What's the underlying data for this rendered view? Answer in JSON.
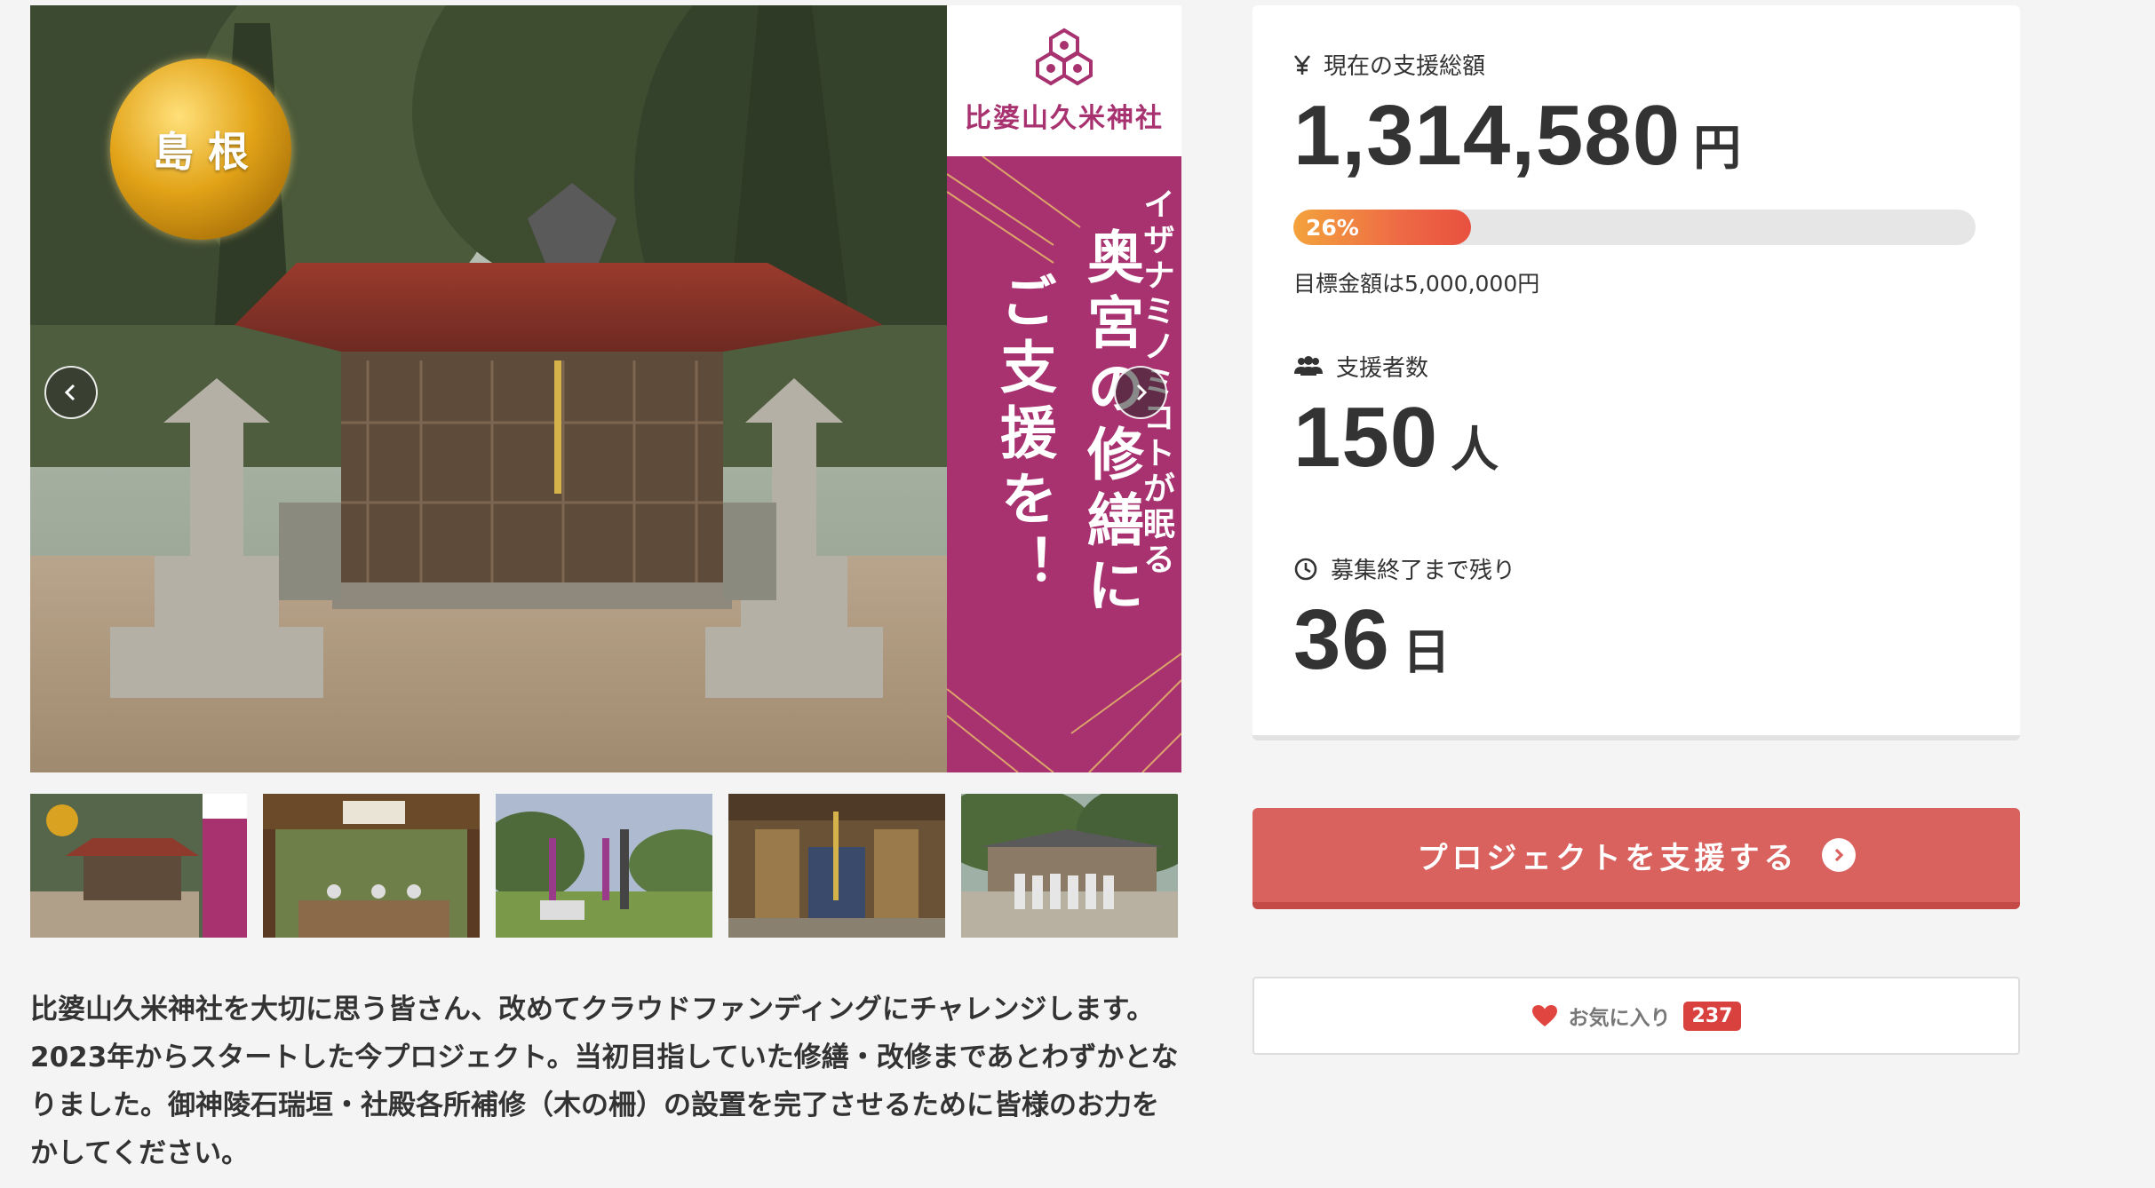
{
  "gallery": {
    "region_badge": "島根",
    "banner": {
      "shrine_name": "比婆山久米神社",
      "subtitle": "イザナミノミコトが眠る",
      "headline_line1": "奥宮の修繕に",
      "headline_line2": "ご支援を！"
    },
    "thumbnail_count": 5
  },
  "description": "比婆山久米神社を大切に思う皆さん、改めてクラウドファンディングにチャレンジします。2023年からスタートした今プロジェクト。当初目指していた修繕・改修まであとわずかとなりました。御神陵石瑞垣・社殿各所補修（木の柵）の設置を完了させるために皆様のお力をかしてください。",
  "stats": {
    "total": {
      "icon": "yen-icon",
      "label": "現在の支援総額",
      "value": "1,314,580",
      "unit": "円"
    },
    "progress": {
      "percent_label": "26%",
      "percent": 26,
      "goal_text": "目標金額は5,000,000円"
    },
    "supporters": {
      "icon": "users-icon",
      "label": "支援者数",
      "value": "150",
      "unit": "人"
    },
    "remaining": {
      "icon": "clock-icon",
      "label": "募集終了まで残り",
      "value": "36",
      "unit": "日"
    }
  },
  "actions": {
    "support_label": "プロジェクトを支援する",
    "favorite_label": "お気に入り",
    "favorite_count": "237"
  },
  "colors": {
    "accent": "#d9625f",
    "banner": "#a7326f",
    "badge_red": "#d9413f"
  }
}
